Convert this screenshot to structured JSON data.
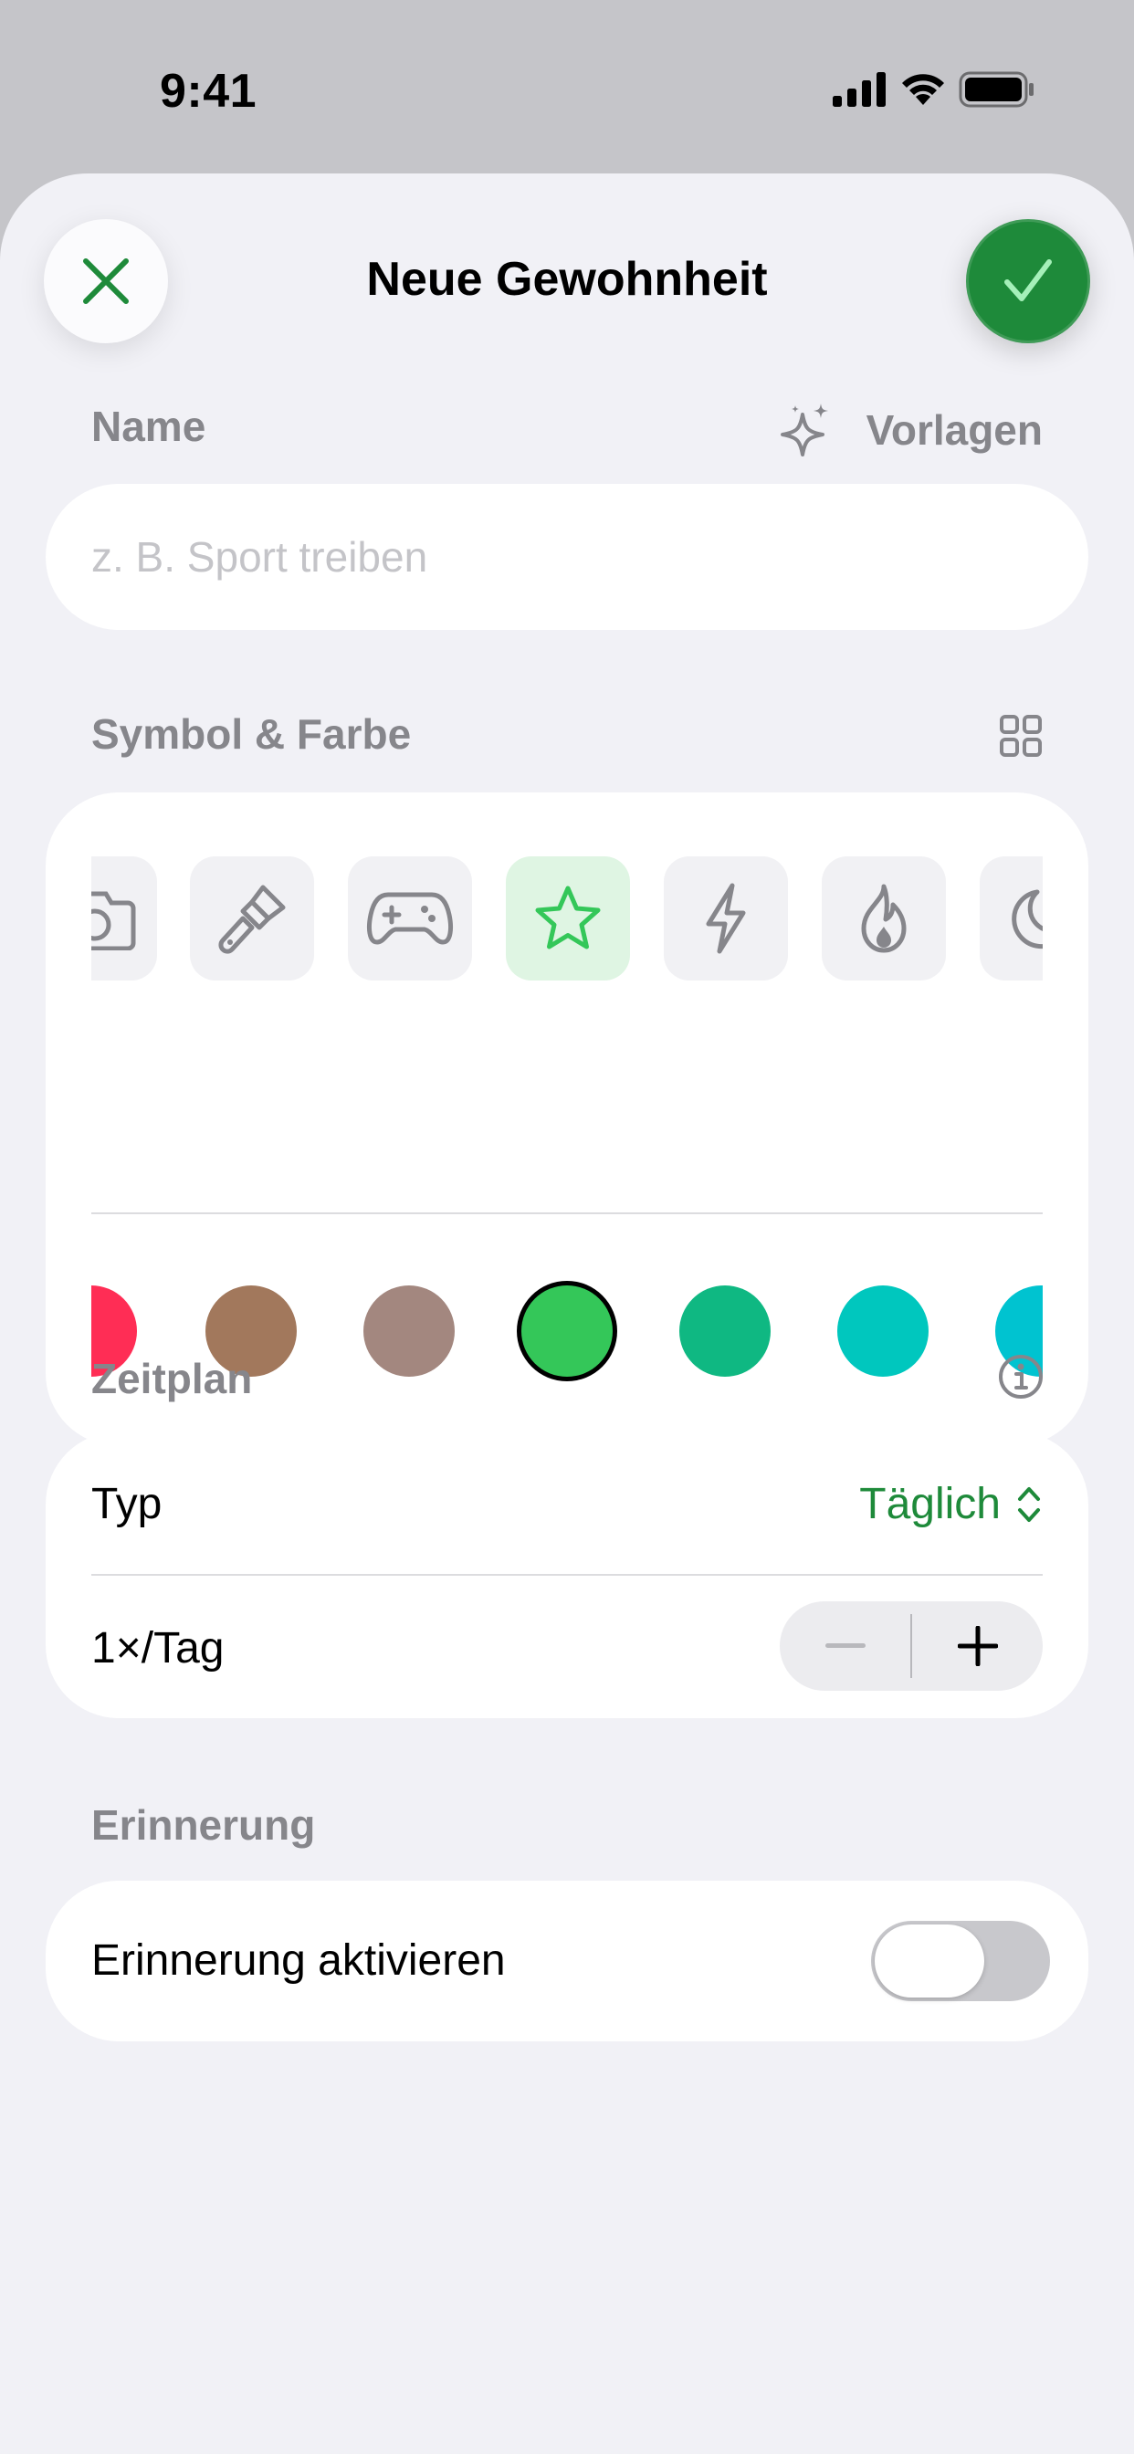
{
  "status_bar": {
    "time": "9:41"
  },
  "header": {
    "title": "Neue Gewohnheit"
  },
  "name_section": {
    "label": "Name",
    "templates_label": "Vorlagen",
    "placeholder": "z. B. Sport treiben",
    "value": ""
  },
  "symbol_section": {
    "label": "Symbol & Farbe",
    "symbols": [
      "camera-icon",
      "paintbrush-icon",
      "gamecontroller-icon",
      "star-icon",
      "bolt-icon",
      "flame-icon",
      "moon-icon"
    ],
    "selected_symbol": "star-icon",
    "colors": [
      "#ff2d55",
      "#a2785c",
      "#a3877f",
      "#34c759",
      "#0fb882",
      "#00c7be",
      "#00c3d0"
    ],
    "selected_color": "#34c759"
  },
  "schedule_section": {
    "label": "Zeitplan",
    "type_label": "Typ",
    "type_value": "Täglich",
    "frequency_label": "1×/Tag"
  },
  "reminder_section": {
    "label": "Erinnerung",
    "toggle_label": "Erinnerung aktivieren",
    "enabled": false
  },
  "colors": {
    "accent": "#1e8a3a",
    "background": "#f1f1f6"
  }
}
